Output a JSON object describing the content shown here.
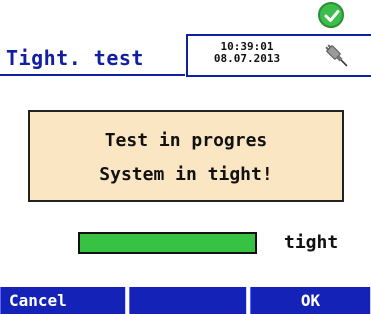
{
  "header": {
    "title": "Tight. test",
    "clock_time": "10:39:01",
    "clock_date": "08.07.2013",
    "status_icon": "green-check-icon",
    "connection_icon": "usb-plug-icon"
  },
  "message": {
    "line1": "Test in progres",
    "line2": "System in tight!"
  },
  "progress": {
    "value": 1.0,
    "label": "tight",
    "fill_color": "#38c244"
  },
  "softkeys": {
    "left_label": "Cancel",
    "middle_label": "",
    "right_label": "OK",
    "color": "#1522b8"
  }
}
